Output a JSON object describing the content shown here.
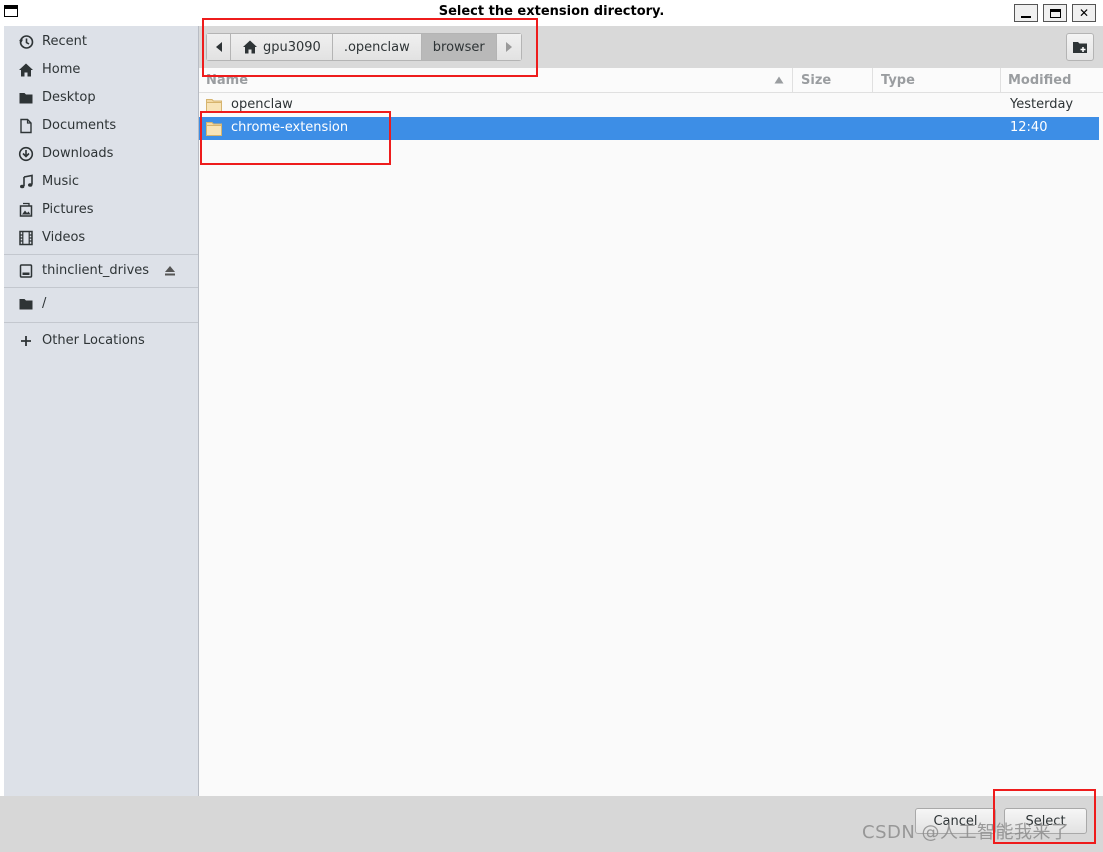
{
  "window": {
    "title": "Select the extension directory."
  },
  "sidebar": {
    "items": [
      {
        "label": "Recent",
        "icon": "recent-icon"
      },
      {
        "label": "Home",
        "icon": "home-icon"
      },
      {
        "label": "Desktop",
        "icon": "folder-icon"
      },
      {
        "label": "Documents",
        "icon": "document-icon"
      },
      {
        "label": "Downloads",
        "icon": "download-icon"
      },
      {
        "label": "Music",
        "icon": "music-icon"
      },
      {
        "label": "Pictures",
        "icon": "pictures-icon"
      },
      {
        "label": "Videos",
        "icon": "videos-icon"
      },
      {
        "label": "thinclient_drives",
        "icon": "drive-icon"
      },
      {
        "label": "/",
        "icon": "folder-icon"
      },
      {
        "label": "Other Locations",
        "icon": "plus-icon"
      }
    ]
  },
  "pathbar": {
    "crumbs": [
      "gpu3090",
      ".openclaw",
      "browser"
    ],
    "active_crumb": "browser"
  },
  "columns": {
    "name": "Name",
    "size": "Size",
    "type": "Type",
    "modified": "Modified"
  },
  "files": [
    {
      "name": "openclaw",
      "size": "",
      "type": "",
      "modified": "Yesterday",
      "selected": false
    },
    {
      "name": "chrome-extension",
      "size": "",
      "type": "",
      "modified": "12:40",
      "selected": true
    }
  ],
  "buttons": {
    "cancel": "Cancel",
    "select": "Select"
  },
  "watermark": "CSDN @人工智能我来了",
  "colors": {
    "selection": "#3d8ee6",
    "sidebar_bg": "#dde1e8",
    "annotation": "#ee1c1c"
  }
}
